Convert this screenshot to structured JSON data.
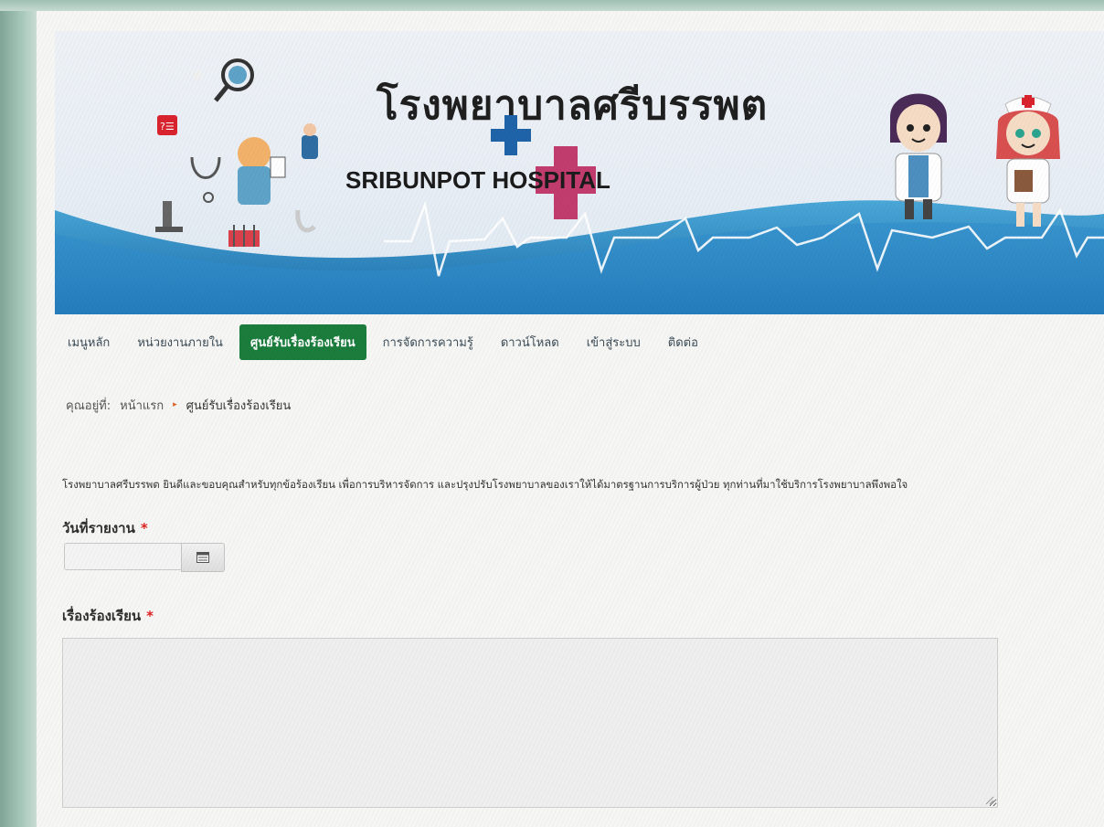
{
  "banner": {
    "title_th": "โรงพยาบาลศรีบรรพต",
    "title_en_part1": "SRIBUNPOT ",
    "title_en_part2": "HOSPITAL"
  },
  "nav": {
    "items": [
      {
        "label": "เมนูหลัก",
        "active": false
      },
      {
        "label": "หน่วยงานภายใน",
        "active": false
      },
      {
        "label": "ศูนย์รับเรื่องร้องเรียน",
        "active": true
      },
      {
        "label": "การจัดการความรู้",
        "active": false
      },
      {
        "label": "ดาวน์โหลด",
        "active": false
      },
      {
        "label": "เข้าสู่ระบบ",
        "active": false
      },
      {
        "label": "ติดต่อ",
        "active": false
      }
    ],
    "active_color": "#1a7d3c"
  },
  "breadcrumb": {
    "prefix": "คุณอยู่ที่:",
    "home": "หน้าแรก",
    "separator": "▸",
    "current": "ศูนย์รับเรื่องร้องเรียน"
  },
  "intro_text": "โรงพยาบาลศรีบรรพต ยินดีและขอบคุณสำหรับทุกข้อร้องเรียน เพื่อการบริหารจัดการ และปรุงปรับโรงพยาบาลของเราให้ได้มาตรฐานการบริการผู้ป่วย ทุกท่านที่มาใช้บริการโรงพยาบาลพึงพอใจ",
  "form": {
    "date_label": "วันที่รายงาน",
    "date_value": "",
    "complaint_label": "เรื่องร้องเรียน",
    "complaint_value": "",
    "required_mark": "*"
  },
  "icons": {
    "calendar_button": "calendar-icon"
  }
}
